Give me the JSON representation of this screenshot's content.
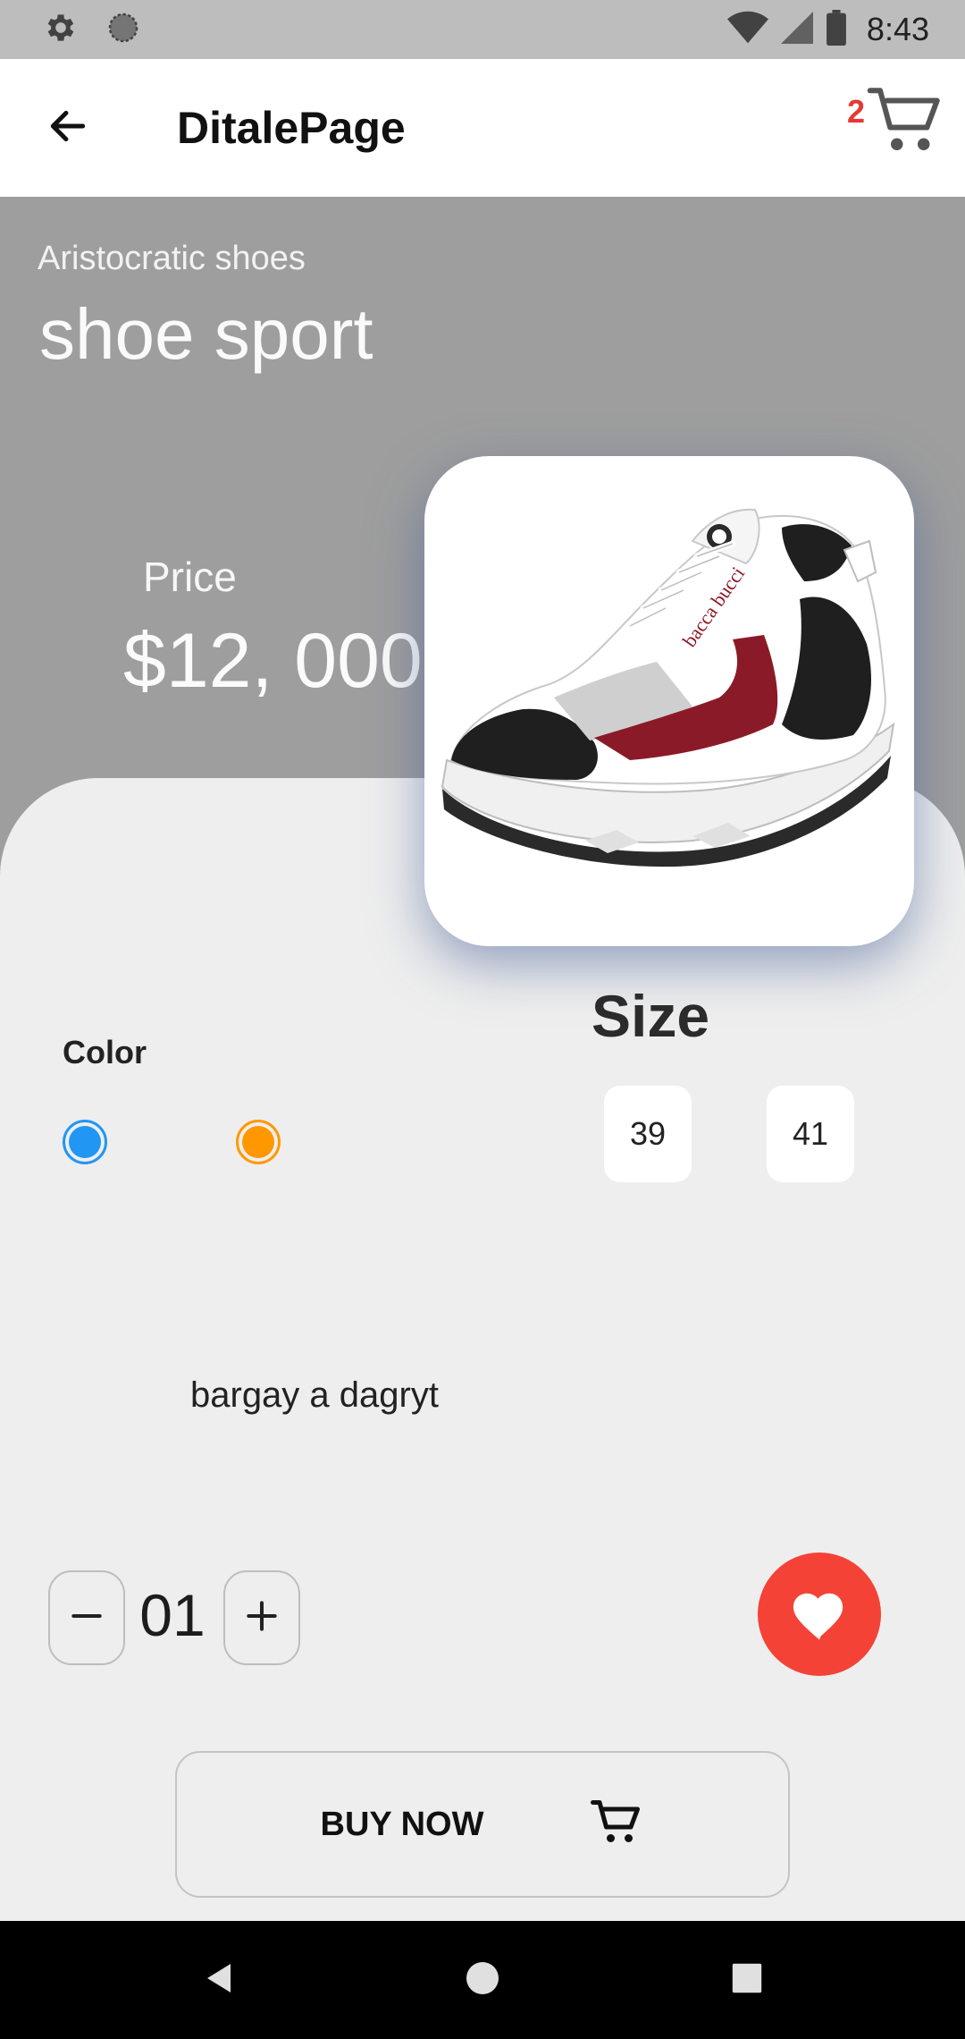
{
  "status_bar": {
    "time": "8:43",
    "icons_left": [
      "settings-icon",
      "sync-icon"
    ],
    "icons_right": [
      "wifi-icon",
      "cell-signal-icon",
      "battery-icon"
    ]
  },
  "app_bar": {
    "title": "DitalePage",
    "cart_count": "2",
    "icons": [
      "arrow-left-icon",
      "shopping-cart-icon"
    ]
  },
  "product": {
    "brand": "Aristocratic shoes",
    "name": "shoe sport",
    "price_label": "Price",
    "price": "$12, 000",
    "image_label": "bacca bucci"
  },
  "colors": {
    "label": "Color",
    "options": [
      {
        "name": "blue",
        "hex": "#2196f3",
        "selected": true
      },
      {
        "name": "orange",
        "hex": "#ff9800",
        "selected": false
      }
    ]
  },
  "sizes": {
    "title": "Size",
    "options": [
      "39",
      "41"
    ]
  },
  "description": "bargay a dagryt",
  "quantity": {
    "value": "01",
    "decrement_icon": "minus-icon",
    "increment_icon": "plus-icon"
  },
  "favorite": {
    "icon": "heart-icon",
    "color": "#f44336"
  },
  "buy": {
    "label": "BUY NOW",
    "icon": "shopping-cart-icon"
  },
  "theme": {
    "hero_bg": "#9e9e9e",
    "sheet_bg": "#eeeeee",
    "cart_badge": "#e53935"
  }
}
